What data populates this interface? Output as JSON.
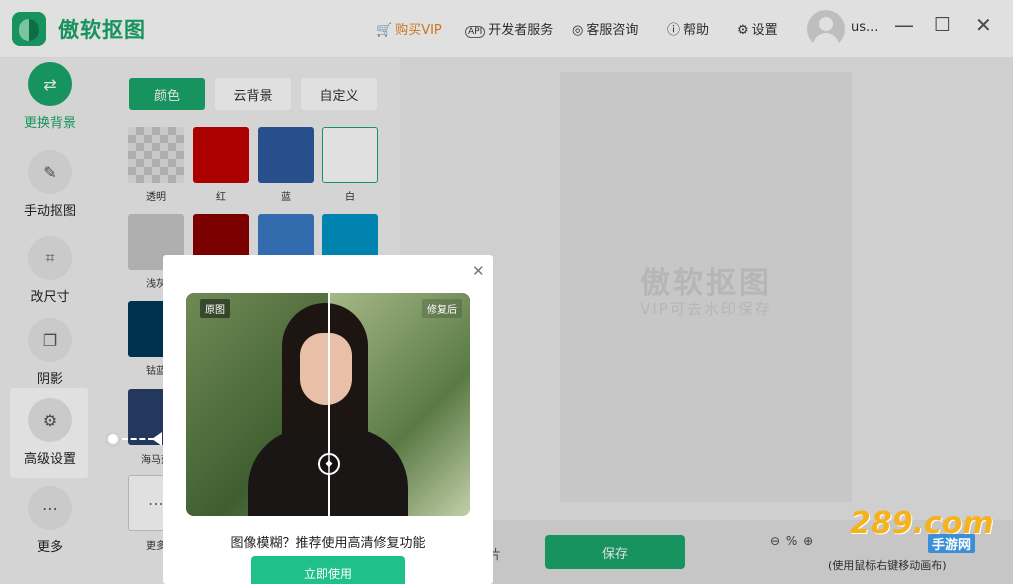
{
  "header": {
    "title": "傲软抠图",
    "nav": [
      {
        "label": "购买VIP",
        "icon": "cart-icon"
      },
      {
        "label": "开发者服务",
        "icon": "api-icon"
      },
      {
        "label": "客服咨询",
        "icon": "chat-icon"
      },
      {
        "label": "帮助",
        "icon": "help-icon"
      },
      {
        "label": "设置",
        "icon": "gear-icon"
      }
    ],
    "username": "us..."
  },
  "sidebar": {
    "items": [
      {
        "label": "更换背景",
        "icon": "swap-background-icon",
        "active": true
      },
      {
        "label": "手动抠图",
        "icon": "manual-cutout-icon"
      },
      {
        "label": "改尺寸",
        "icon": "crop-icon"
      },
      {
        "label": "阴影",
        "icon": "shadow-icon"
      },
      {
        "label": "高级设置",
        "icon": "advanced-settings-icon"
      },
      {
        "label": "更多",
        "icon": "more-icon"
      }
    ]
  },
  "panel": {
    "tabs": [
      "颜色",
      "云背景",
      "自定义"
    ],
    "swatches": [
      {
        "label": "透明",
        "color": "transparent"
      },
      {
        "label": "红",
        "color": "#c40000"
      },
      {
        "label": "蓝",
        "color": "#2c5aa0"
      },
      {
        "label": "白",
        "color": "#ffffff"
      },
      {
        "label": "浅灰",
        "color": "#c8c8c8"
      },
      {
        "label": "",
        "color": "#8b0000"
      },
      {
        "label": "",
        "color": "#3a7bc8"
      },
      {
        "label": "",
        "color": "#0096c8"
      },
      {
        "label": "钴蓝",
        "color": "#003a5a"
      },
      {
        "label": "海马蓝",
        "color": "#2a3f6a"
      },
      {
        "label": "更多",
        "color": "#ffffff"
      }
    ]
  },
  "canvas": {
    "watermark_title": "傲软抠图",
    "watermark_sub": "VIP可去水印保存",
    "picture_label": "片",
    "save_label": "保存",
    "zoom_text": "%",
    "hint": "(使用鼠标右键移动画布)"
  },
  "popup": {
    "tag_before": "原图",
    "tag_after": "修复后",
    "text": "图像模糊？推荐使用高清修复功能",
    "button": "立即使用"
  },
  "brand_watermark": {
    "main": "289.com",
    "sub": "手游网"
  }
}
